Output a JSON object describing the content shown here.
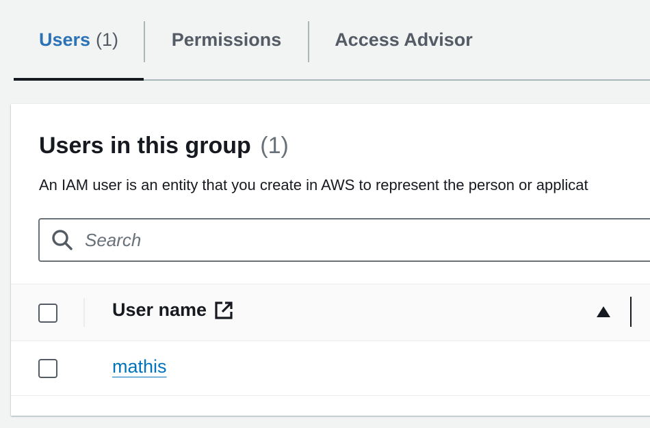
{
  "tabs": [
    {
      "label": "Users",
      "count": "(1)",
      "active": true
    },
    {
      "label": "Permissions",
      "active": false
    },
    {
      "label": "Access Advisor",
      "active": false
    }
  ],
  "panel": {
    "title": "Users in this group",
    "count": "(1)",
    "description": "An IAM user is an entity that you create in AWS to represent the person or applicat"
  },
  "search": {
    "placeholder": "Search",
    "value": ""
  },
  "table": {
    "columns": [
      {
        "label": "User name",
        "sort": "ascending"
      }
    ],
    "rows": [
      {
        "user_name": "mathis"
      }
    ]
  },
  "colors": {
    "accent": "#2b73b6",
    "link": "#0073bb",
    "text": "#16191f",
    "muted": "#545b64",
    "background": "#f2f3f3"
  },
  "icons": {
    "search": "search-icon",
    "external": "external-link-icon",
    "sort": "sort-ascending-icon"
  }
}
